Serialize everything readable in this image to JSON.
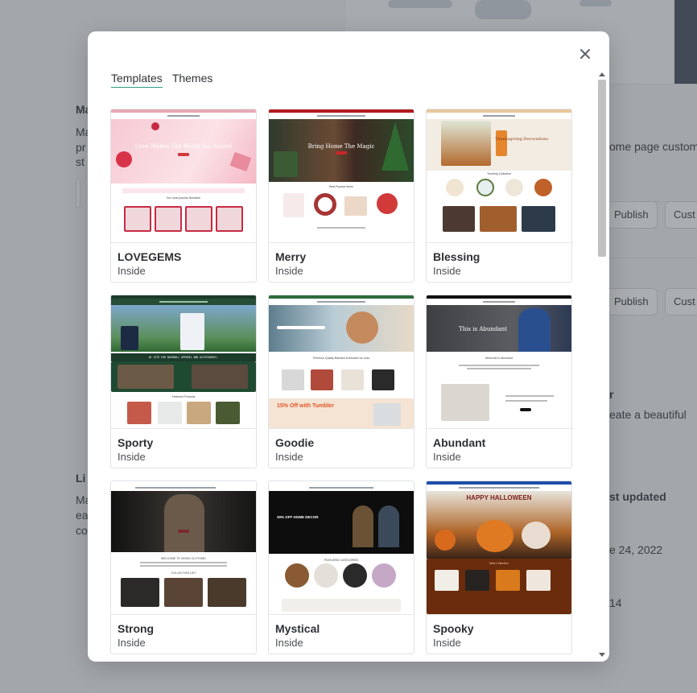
{
  "background": {
    "fragments": [
      "Ma",
      "Ma",
      "pr",
      "st",
      "ome page custom",
      "Publish",
      "Cust",
      "Publish",
      "Cust",
      "r",
      "eate a beautiful",
      "Li",
      "Ma",
      "ea",
      "co",
      "st updated",
      "e 24, 2022",
      "14"
    ]
  },
  "modal": {
    "tabs": [
      {
        "label": "Templates",
        "active": true
      },
      {
        "label": "Themes",
        "active": false
      }
    ],
    "close_icon": "close-icon",
    "templates": [
      {
        "name": "LOVEGEMS",
        "type": "Inside",
        "hero_text": "Love Makes The World Go 'Round",
        "section_text": "Our most popular Necklace"
      },
      {
        "name": "Merry",
        "type": "Inside",
        "hero_text": "Bring Home The Magic",
        "section_text": "Best Popular Items"
      },
      {
        "name": "Blessing",
        "type": "Inside",
        "hero_text": "Thanksgiving Decorations",
        "section_text": "Trending Collection"
      },
      {
        "name": "Sporty",
        "type": "Inside",
        "hero_text": "#1 SITE FOR BASEBALL APPAREL AND ACCESSORIES.",
        "section_text": "Featured Products"
      },
      {
        "name": "Goodie",
        "type": "Inside",
        "hero_text": "Premium Quality Branded Drinkware for Less",
        "section_text": "15% Off with Tumbler"
      },
      {
        "name": "Abundant",
        "type": "Inside",
        "hero_text": "This is Abundant",
        "section_text": "Welcome to Abundant"
      },
      {
        "name": "Strong",
        "type": "Inside",
        "hero_text": "WELCOME TO VIKING CLOTHING",
        "section_text": "COLLECTION LIST"
      },
      {
        "name": "Mystical",
        "type": "Inside",
        "hero_text": "30% OFF HOME DECOR",
        "section_text": "FEATURED CATEGORIES"
      },
      {
        "name": "Spooky",
        "type": "Inside",
        "hero_text": "HAPPY HALLOWEEN",
        "section_text": "Best Collection"
      }
    ]
  },
  "colors": {
    "accent": "#2e9c86",
    "overlay": "#343c44",
    "card_border": "#dfe2e5"
  }
}
